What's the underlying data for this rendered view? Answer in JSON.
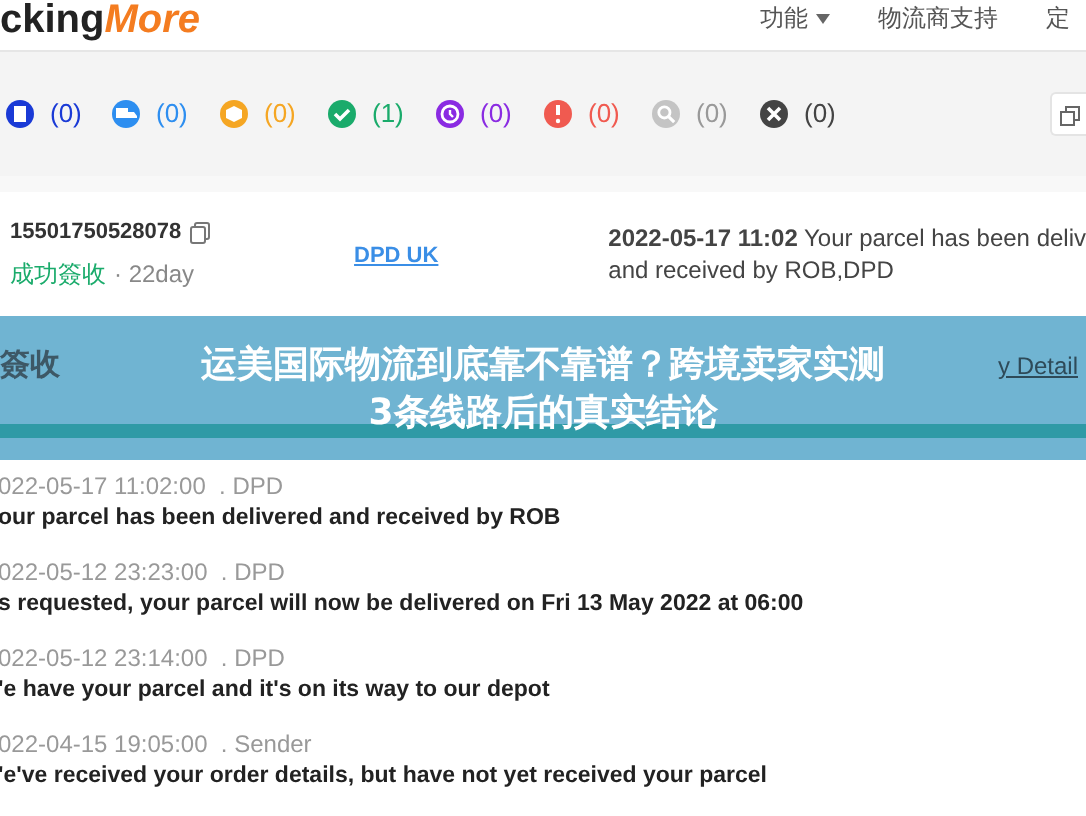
{
  "header": {
    "logo_dark": "cking",
    "logo_accent": "More",
    "nav": [
      {
        "label": "功能",
        "dropdown": true
      },
      {
        "label": "物流商支持",
        "dropdown": false
      },
      {
        "label": "定",
        "dropdown": false
      }
    ]
  },
  "status_filters": [
    {
      "kind": "document",
      "count": "(0)",
      "color": "#1a3ad6"
    },
    {
      "kind": "truck",
      "count": "(0)",
      "color": "#2d8ef0"
    },
    {
      "kind": "box",
      "count": "(0)",
      "color": "#f5a623"
    },
    {
      "kind": "check",
      "count": "(1)",
      "color": "#1aab6b"
    },
    {
      "kind": "clock",
      "count": "(0)",
      "color": "#8a2be2"
    },
    {
      "kind": "alert",
      "count": "(0)",
      "color": "#f05a50"
    },
    {
      "kind": "search",
      "count": "(0)",
      "color": "#c4c4c4"
    },
    {
      "kind": "cross",
      "count": "(0)",
      "color": "#444444"
    }
  ],
  "shipment": {
    "tracking_number": "15501750528078",
    "status": "成功簽收",
    "age": "· 22day",
    "carrier": "DPD UK",
    "latest_time": "2022-05-17 11:02",
    "latest_text": "Your parcel has been deliv",
    "latest_text_2": "and received by ROB,DPD"
  },
  "summary": {
    "status": "簽收",
    "link": "y Detail"
  },
  "banner": {
    "line1": "运美国际物流到底靠不靠谱？跨境卖家实测",
    "line2": "3条线路后的真实结论"
  },
  "events": [
    {
      "time": "022-05-17 11:02:00",
      "source": ". DPD",
      "text": "our parcel has been delivered and received by ROB"
    },
    {
      "time": "022-05-12 23:23:00",
      "source": ". DPD",
      "text": "s requested, your parcel will now be delivered on Fri 13 May 2022 at 06:00"
    },
    {
      "time": "022-05-12 23:14:00",
      "source": ". DPD",
      "text": "'e have your parcel and it's on its way to our depot"
    },
    {
      "time": "022-04-15 19:05:00",
      "source": ". Sender",
      "text": "'e've received your order details, but have not yet received your parcel"
    }
  ]
}
